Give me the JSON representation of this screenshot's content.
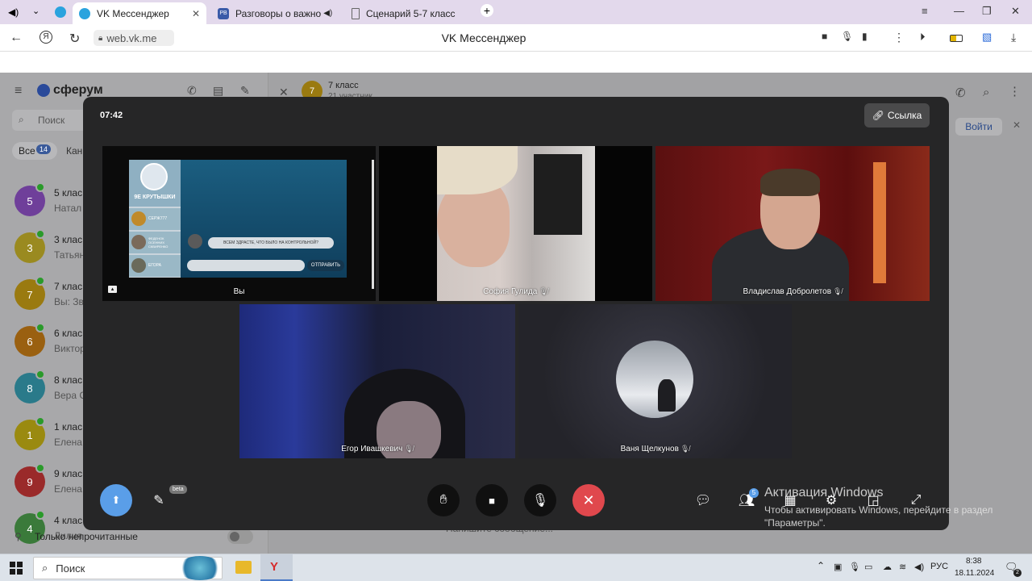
{
  "browser": {
    "tabs": [
      {
        "label": "VK Мессенджер",
        "active": true
      },
      {
        "label": "Разговоры о важно",
        "active": false
      },
      {
        "label": "Сценарий 5-7 класс",
        "active": false
      }
    ],
    "url": "web.vk.me",
    "page_title": "VK Мессенджер"
  },
  "vk": {
    "brand": "сферум",
    "search_placeholder": "Поиск",
    "filter_all": "Все",
    "filter_all_count": "14",
    "filter_next": "Кан",
    "chat_header_title": "7 класс",
    "chat_header_sub": "21 участник",
    "join_label": "Войти",
    "chats": [
      {
        "name": "5 клас",
        "sub": "Натал",
        "avatar": "5",
        "color": "#6f3f9a"
      },
      {
        "name": "3 клас",
        "sub": "Татьян",
        "avatar": "3",
        "color": "#9a8a20"
      },
      {
        "name": "7 клас",
        "sub": "Вы: Зв",
        "avatar": "7",
        "color": "#9a7a10"
      },
      {
        "name": "6 клас",
        "sub": "Виктор",
        "avatar": "6",
        "color": "#9a6010"
      },
      {
        "name": "8 клас",
        "sub": "Вера С",
        "avatar": "8",
        "color": "#2a7a8a"
      },
      {
        "name": "1 клас",
        "sub": "Елена",
        "avatar": "1",
        "color": "#9a8a10"
      },
      {
        "name": "9 клас",
        "sub": "Елена",
        "avatar": "9",
        "color": "#9a2a2a"
      },
      {
        "name": "4 клас",
        "sub": "Лилия",
        "avatar": "4",
        "color": "#3a7a3a"
      }
    ],
    "unread_only": "Только непрочитанные",
    "message_placeholder": "Напишите сообщение..."
  },
  "call": {
    "timer": "07:42",
    "link_label": "Ссылка",
    "participants": [
      {
        "name": "Вы",
        "muted": false
      },
      {
        "name": "София Гулида",
        "muted": true
      },
      {
        "name": "Владислав Добролетов",
        "muted": true
      },
      {
        "name": "Егор Ивашкевич",
        "muted": true
      },
      {
        "name": "Ваня Щелкунов",
        "muted": true
      }
    ],
    "shared_screen": {
      "title": "9Е КРУТЫШКИ",
      "contacts": [
        "СЕРЖ777",
        "ФЕДЕНОК ОСЕННИХ СКВИРЕНКО",
        "ЕГОРА"
      ],
      "message": "ВСЕМ ЗДРАСТЕ, ЧТО БЫЛО НА КОНТРОЛЬНОЙ?",
      "send_label": "ОТПРАВИТЬ"
    },
    "beta_badge": "beta",
    "participants_count": "5"
  },
  "watermark": {
    "title": "Активация Windows",
    "subtitle": "Чтобы активировать Windows, перейдите в раздел \"Параметры\"."
  },
  "taskbar": {
    "search_label": "Поиск",
    "lang": "РУС",
    "time": "8:38",
    "date": "18.11.2024",
    "notifications": "2"
  },
  "colors": {
    "end_call": "#e0484d",
    "share_active": "#5a9ee8",
    "modal_bg": "#262627"
  }
}
